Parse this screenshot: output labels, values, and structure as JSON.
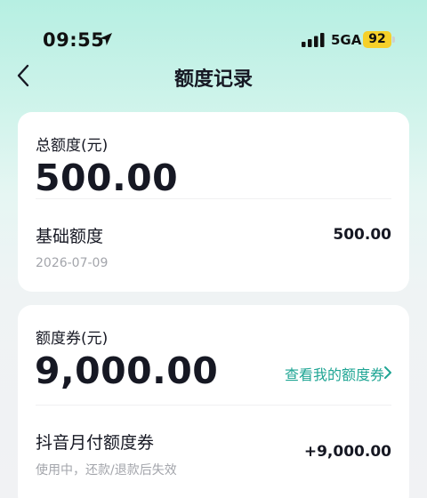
{
  "status_bar": {
    "time": "09:55",
    "network": "5GA",
    "battery": "92",
    "icons": [
      "location-arrow-icon",
      "signal-bars-icon",
      "battery-icon"
    ]
  },
  "nav": {
    "title": "额度记录",
    "back_icon": "chevron-left-icon"
  },
  "total_card": {
    "label": "总额度(元)",
    "amount": "500.00",
    "item": {
      "title": "基础额度",
      "date": "2026-07-09",
      "value": "500.00"
    }
  },
  "coupon_card": {
    "label": "额度券(元)",
    "amount": "9,000.00",
    "link": "查看我的额度券",
    "item": {
      "title": "抖音月付额度券",
      "note": "使用中，还款/退款后失效",
      "value": "+9,000.00"
    }
  },
  "colors": {
    "accent": "#1fa594",
    "battery": "#f6d02a",
    "text_primary": "#161823",
    "text_secondary": "#a3a5ab"
  }
}
